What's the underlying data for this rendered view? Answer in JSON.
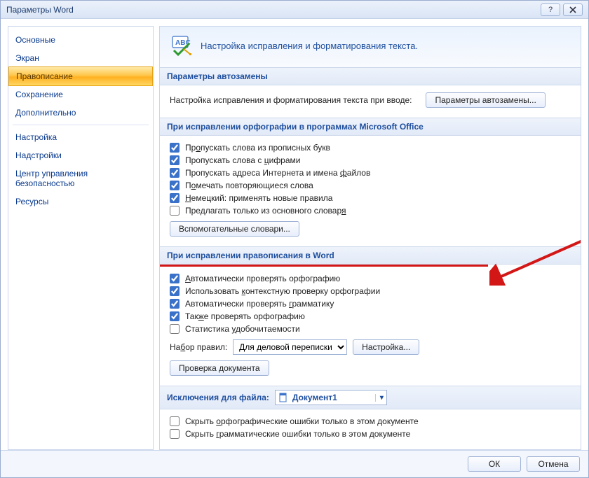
{
  "window": {
    "title": "Параметры Word"
  },
  "sidebar": {
    "items": [
      "Основные",
      "Экран",
      "Правописание",
      "Сохранение",
      "Дополнительно",
      "Настройка",
      "Надстройки",
      "Центр управления безопасностью",
      "Ресурсы"
    ],
    "selected_index": 2
  },
  "hero": {
    "title": "Настройка исправления и форматирования текста."
  },
  "sections": {
    "autocorrect": {
      "title": "Параметры автозамены",
      "desc": "Настройка исправления и форматирования текста при вводе:",
      "button": "Параметры автозамены..."
    },
    "office_spell": {
      "title": "При исправлении орфографии в программах Microsoft Office",
      "checks": [
        {
          "label_pre": "Пр",
          "u": "о",
          "label_post": "пускать слова из прописных букв",
          "checked": true
        },
        {
          "label_pre": "Пропускать слова с ",
          "u": "ц",
          "label_post": "ифрами",
          "checked": true
        },
        {
          "label_pre": "Пропускать адреса Интернета и имена ",
          "u": "ф",
          "label_post": "айлов",
          "checked": true
        },
        {
          "label_pre": "П",
          "u": "о",
          "label_post": "мечать повторяющиеся слова",
          "checked": true
        },
        {
          "label_pre": "",
          "u": "Н",
          "label_post": "емецкий: применять новые правила",
          "checked": true
        },
        {
          "label_pre": "Предлагать только из основного словар",
          "u": "я",
          "label_post": "",
          "checked": false
        }
      ],
      "aux_button": "Вспомогательные словари..."
    },
    "word_spell": {
      "title": "При исправлении правописания в Word",
      "checks": [
        {
          "label_pre": "",
          "u": "А",
          "label_post": "втоматически проверять орфографию",
          "checked": true
        },
        {
          "label_pre": "Использовать ",
          "u": "к",
          "label_post": "онтекстную проверку орфографии",
          "checked": true
        },
        {
          "label_pre": "Автоматически проверять ",
          "u": "г",
          "label_post": "рамматику",
          "checked": true
        },
        {
          "label_pre": "Так",
          "u": "ж",
          "label_post": "е проверять орфографию",
          "checked": true
        },
        {
          "label_pre": "Статистика ",
          "u": "у",
          "label_post": "добочитаемости",
          "checked": false
        }
      ],
      "ruleset_label_pre": "На",
      "ruleset_u": "б",
      "ruleset_label_post": "ор правил:",
      "ruleset_value": "Для деловой переписки",
      "settings_button": "Настройка...",
      "check_doc_button": "Проверка документа"
    },
    "exceptions": {
      "title": "Исключения для файла:",
      "file_value": "Документ1",
      "checks": [
        {
          "label_pre": "Скрыть ",
          "u": "о",
          "label_post": "рфографические ошибки только в этом документе",
          "checked": false
        },
        {
          "label_pre": "Скрыть ",
          "u": "г",
          "label_post": "рамматические ошибки только в этом документе",
          "checked": false
        }
      ]
    }
  },
  "footer": {
    "ok": "ОК",
    "cancel": "Отмена"
  }
}
